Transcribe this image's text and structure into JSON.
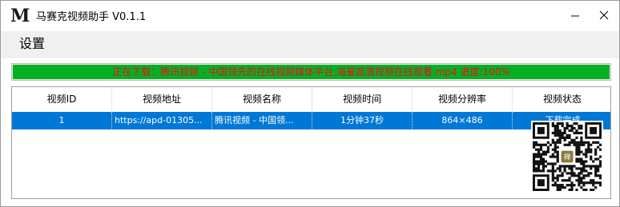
{
  "titlebar": {
    "logo": "M",
    "title": "马赛克视频助手 V0.1.1"
  },
  "menu": {
    "items": [
      "设置"
    ]
  },
  "progress": {
    "text": "正在下载：腾讯视频 - 中国领先的在线视频媒体平台,海量高清视频在线观看.mp4 进度:100%",
    "percent": 100,
    "fill_color": "#06b025",
    "text_color": "#e8101a"
  },
  "table": {
    "columns": [
      "视频ID",
      "视频地址",
      "视频名称",
      "视频时间",
      "视频分辨率",
      "视频状态"
    ],
    "rows": [
      {
        "id": "1",
        "url": "https://apd-01305...",
        "name": "腾讯视频 - 中国领...",
        "duration": "1分钟37秒",
        "resolution": "864×486",
        "status": "下载完成"
      }
    ],
    "selected_row_color": "#0078d7"
  },
  "overlay": {
    "qr_center_char": "禅"
  }
}
